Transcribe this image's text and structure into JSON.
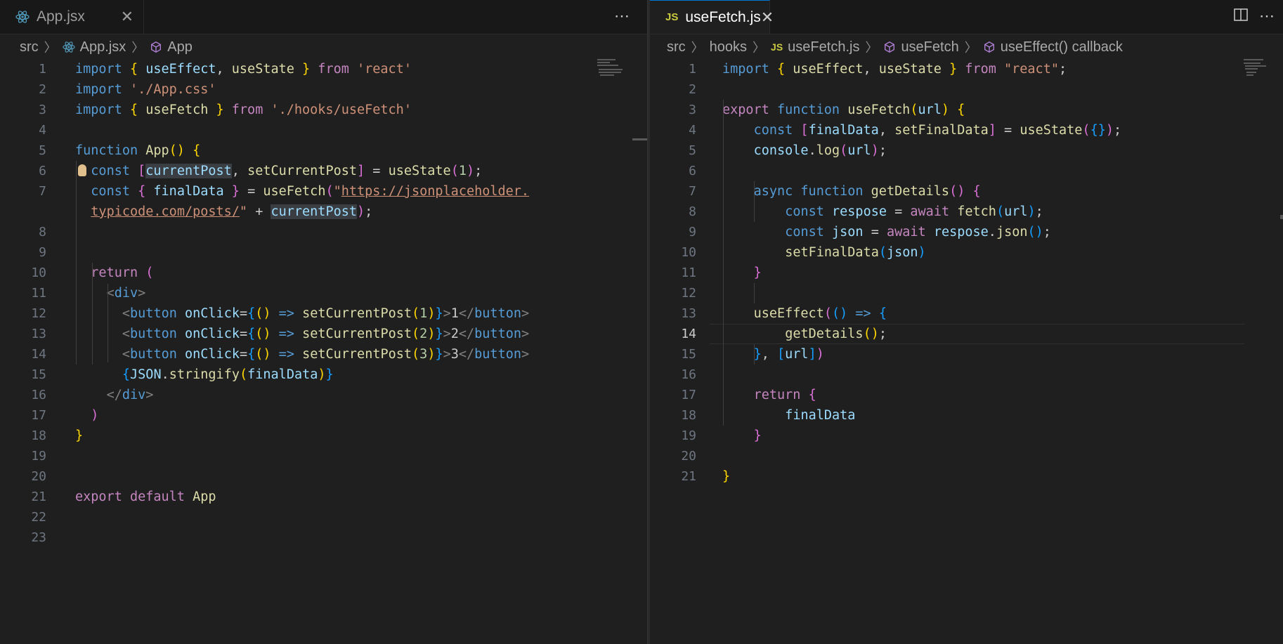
{
  "left_editor": {
    "tab": {
      "label": "App.jsx"
    },
    "breadcrumb": {
      "segments": [
        "src",
        "App.jsx",
        "App"
      ]
    },
    "lines": [
      {
        "n": "1",
        "tokens": [
          [
            "kw",
            "import "
          ],
          [
            "br1",
            "{ "
          ],
          [
            "var",
            "useEffect"
          ],
          [
            "plain",
            ", "
          ],
          [
            "fn",
            "useState"
          ],
          [
            "br1",
            " }"
          ],
          [
            "ctl",
            " from "
          ],
          [
            "str",
            "'react'"
          ]
        ]
      },
      {
        "n": "2",
        "tokens": [
          [
            "kw",
            "import "
          ],
          [
            "str",
            "'./App.css'"
          ]
        ]
      },
      {
        "n": "3",
        "tokens": [
          [
            "kw",
            "import "
          ],
          [
            "br1",
            "{ "
          ],
          [
            "fn",
            "useFetch"
          ],
          [
            "br1",
            " }"
          ],
          [
            "ctl",
            " from "
          ],
          [
            "str",
            "'./hooks/useFetch'"
          ]
        ]
      },
      {
        "n": "4",
        "tokens": []
      },
      {
        "n": "5",
        "tokens": [
          [
            "kw",
            "function "
          ],
          [
            "fn",
            "App"
          ],
          [
            "br1",
            "()"
          ],
          [
            "plain",
            " "
          ],
          [
            "br1",
            "{"
          ]
        ]
      },
      {
        "n": "6",
        "tokens": [
          [
            "kw",
            "const "
          ],
          [
            "br2",
            "["
          ],
          [
            "var hl",
            "currentPost"
          ],
          [
            "plain",
            ", "
          ],
          [
            "fn",
            "setCurrentPost"
          ],
          [
            "br2",
            "]"
          ],
          [
            "plain",
            " = "
          ],
          [
            "fn",
            "useState"
          ],
          [
            "br2",
            "("
          ],
          [
            "num",
            "1"
          ],
          [
            "br2",
            ")"
          ],
          [
            "plain",
            ";"
          ]
        ]
      },
      {
        "n": "7",
        "tokens": [
          [
            "kw",
            "const "
          ],
          [
            "br2",
            "{ "
          ],
          [
            "var",
            "finalData"
          ],
          [
            "br2",
            " }"
          ],
          [
            "plain",
            " = "
          ],
          [
            "fn",
            "useFetch"
          ],
          [
            "br2",
            "("
          ],
          [
            "str",
            "\""
          ],
          [
            "str u",
            "https://jsonplaceholder."
          ]
        ]
      },
      {
        "n": "",
        "tokens": [
          [
            "str u",
            "typicode.com/posts/"
          ],
          [
            "str",
            "\""
          ],
          [
            "plain",
            " + "
          ],
          [
            "var hl",
            "currentPost"
          ],
          [
            "br2",
            ")"
          ],
          [
            "plain",
            ";"
          ]
        ]
      },
      {
        "n": "8",
        "tokens": []
      },
      {
        "n": "9",
        "tokens": []
      },
      {
        "n": "10",
        "tokens": [
          [
            "ctl",
            "return "
          ],
          [
            "br2",
            "("
          ]
        ]
      },
      {
        "n": "11",
        "tokens": [
          [
            "tagb",
            "<"
          ],
          [
            "tag",
            "div"
          ],
          [
            "tagb",
            ">"
          ]
        ]
      },
      {
        "n": "12",
        "tokens": [
          [
            "tagb",
            "<"
          ],
          [
            "tag",
            "button "
          ],
          [
            "attr",
            "onClick"
          ],
          [
            "plain",
            "="
          ],
          [
            "br3",
            "{"
          ],
          [
            "br1",
            "()"
          ],
          [
            "kw",
            " => "
          ],
          [
            "fn",
            "setCurrentPost"
          ],
          [
            "br1",
            "("
          ],
          [
            "num",
            "1"
          ],
          [
            "br1",
            ")"
          ],
          [
            "br3",
            "}"
          ],
          [
            "tagb",
            ">"
          ],
          [
            "plain",
            "1"
          ],
          [
            "tagb",
            "</"
          ],
          [
            "tag",
            "button"
          ],
          [
            "tagb",
            ">"
          ]
        ]
      },
      {
        "n": "13",
        "tokens": [
          [
            "tagb",
            "<"
          ],
          [
            "tag",
            "button "
          ],
          [
            "attr",
            "onClick"
          ],
          [
            "plain",
            "="
          ],
          [
            "br3",
            "{"
          ],
          [
            "br1",
            "()"
          ],
          [
            "kw",
            " => "
          ],
          [
            "fn",
            "setCurrentPost"
          ],
          [
            "br1",
            "("
          ],
          [
            "num",
            "2"
          ],
          [
            "br1",
            ")"
          ],
          [
            "br3",
            "}"
          ],
          [
            "tagb",
            ">"
          ],
          [
            "plain",
            "2"
          ],
          [
            "tagb",
            "</"
          ],
          [
            "tag",
            "button"
          ],
          [
            "tagb",
            ">"
          ]
        ]
      },
      {
        "n": "14",
        "tokens": [
          [
            "tagb",
            "<"
          ],
          [
            "tag",
            "button "
          ],
          [
            "attr",
            "onClick"
          ],
          [
            "plain",
            "="
          ],
          [
            "br3",
            "{"
          ],
          [
            "br1",
            "()"
          ],
          [
            "kw",
            " => "
          ],
          [
            "fn",
            "setCurrentPost"
          ],
          [
            "br1",
            "("
          ],
          [
            "num",
            "3"
          ],
          [
            "br1",
            ")"
          ],
          [
            "br3",
            "}"
          ],
          [
            "tagb",
            ">"
          ],
          [
            "plain",
            "3"
          ],
          [
            "tagb",
            "</"
          ],
          [
            "tag",
            "button"
          ],
          [
            "tagb",
            ">"
          ]
        ]
      },
      {
        "n": "15",
        "tokens": [
          [
            "br3",
            "{"
          ],
          [
            "var",
            "JSON"
          ],
          [
            "plain",
            "."
          ],
          [
            "fn",
            "stringify"
          ],
          [
            "br1",
            "("
          ],
          [
            "var",
            "finalData"
          ],
          [
            "br1",
            ")"
          ],
          [
            "br3",
            "}"
          ]
        ]
      },
      {
        "n": "16",
        "tokens": [
          [
            "tagb",
            "</"
          ],
          [
            "tag",
            "div"
          ],
          [
            "tagb",
            ">"
          ]
        ]
      },
      {
        "n": "17",
        "tokens": [
          [
            "br2",
            ")"
          ]
        ]
      },
      {
        "n": "18",
        "tokens": [
          [
            "br1",
            "}"
          ]
        ]
      },
      {
        "n": "19",
        "tokens": []
      },
      {
        "n": "20",
        "tokens": []
      },
      {
        "n": "21",
        "tokens": [
          [
            "ctl",
            "export default "
          ],
          [
            "fn",
            "App"
          ]
        ]
      },
      {
        "n": "22",
        "tokens": []
      },
      {
        "n": "23",
        "tokens": []
      }
    ]
  },
  "right_editor": {
    "tab": {
      "label": "useFetch.js",
      "file_badge": "JS"
    },
    "breadcrumb": {
      "segments": [
        "src",
        "hooks",
        "useFetch.js",
        "useFetch",
        "useEffect() callback"
      ],
      "file_badge": "JS"
    },
    "active_line": "14",
    "lines": [
      {
        "n": "1",
        "tokens": [
          [
            "kw",
            "import "
          ],
          [
            "br1",
            "{ "
          ],
          [
            "fn",
            "useEffect"
          ],
          [
            "plain",
            ", "
          ],
          [
            "fn",
            "useState"
          ],
          [
            "br1",
            " }"
          ],
          [
            "ctl",
            " from "
          ],
          [
            "str",
            "\"react\""
          ],
          [
            "plain",
            ";"
          ]
        ]
      },
      {
        "n": "2",
        "tokens": []
      },
      {
        "n": "3",
        "tokens": [
          [
            "ctl",
            "export "
          ],
          [
            "kw",
            "function "
          ],
          [
            "fn",
            "useFetch"
          ],
          [
            "br1",
            "("
          ],
          [
            "var",
            "url"
          ],
          [
            "br1",
            ")"
          ],
          [
            "plain",
            " "
          ],
          [
            "br1",
            "{"
          ]
        ]
      },
      {
        "n": "4",
        "tokens": [
          [
            "kw",
            "const "
          ],
          [
            "br2",
            "["
          ],
          [
            "var",
            "finalData"
          ],
          [
            "plain",
            ", "
          ],
          [
            "fn",
            "setFinalData"
          ],
          [
            "br2",
            "]"
          ],
          [
            "plain",
            " = "
          ],
          [
            "fn",
            "useState"
          ],
          [
            "br2",
            "("
          ],
          [
            "br3",
            "{}"
          ],
          [
            "br2",
            ")"
          ],
          [
            "plain",
            ";"
          ]
        ]
      },
      {
        "n": "5",
        "tokens": [
          [
            "var",
            "console"
          ],
          [
            "plain",
            "."
          ],
          [
            "fn",
            "log"
          ],
          [
            "br2",
            "("
          ],
          [
            "var",
            "url"
          ],
          [
            "br2",
            ")"
          ],
          [
            "plain",
            ";"
          ]
        ]
      },
      {
        "n": "6",
        "tokens": []
      },
      {
        "n": "7",
        "tokens": [
          [
            "kw",
            "async function "
          ],
          [
            "fn",
            "getDetails"
          ],
          [
            "br2",
            "()"
          ],
          [
            "plain",
            " "
          ],
          [
            "br2",
            "{"
          ]
        ]
      },
      {
        "n": "8",
        "tokens": [
          [
            "kw",
            "const "
          ],
          [
            "var",
            "respose"
          ],
          [
            "plain",
            " = "
          ],
          [
            "ctl",
            "await "
          ],
          [
            "fn",
            "fetch"
          ],
          [
            "br3",
            "("
          ],
          [
            "var",
            "url"
          ],
          [
            "br3",
            ")"
          ],
          [
            "plain",
            ";"
          ]
        ]
      },
      {
        "n": "9",
        "tokens": [
          [
            "kw",
            "const "
          ],
          [
            "var",
            "json"
          ],
          [
            "plain",
            " = "
          ],
          [
            "ctl",
            "await "
          ],
          [
            "var",
            "respose"
          ],
          [
            "plain",
            "."
          ],
          [
            "fn",
            "json"
          ],
          [
            "br3",
            "()"
          ],
          [
            "plain",
            ";"
          ]
        ]
      },
      {
        "n": "10",
        "tokens": [
          [
            "fn",
            "setFinalData"
          ],
          [
            "br3",
            "("
          ],
          [
            "var",
            "json"
          ],
          [
            "br3",
            ")"
          ]
        ]
      },
      {
        "n": "11",
        "tokens": [
          [
            "br2",
            "}"
          ]
        ]
      },
      {
        "n": "12",
        "tokens": []
      },
      {
        "n": "13",
        "tokens": [
          [
            "fn",
            "useEffect"
          ],
          [
            "br2",
            "("
          ],
          [
            "br3",
            "()"
          ],
          [
            "kw",
            " => "
          ],
          [
            "br3",
            "{"
          ]
        ]
      },
      {
        "n": "14",
        "tokens": [
          [
            "fn",
            "getDetails"
          ],
          [
            "br1",
            "()"
          ],
          [
            "plain",
            ";"
          ]
        ]
      },
      {
        "n": "15",
        "tokens": [
          [
            "br3",
            "}"
          ],
          [
            "plain",
            ", "
          ],
          [
            "br3",
            "["
          ],
          [
            "var",
            "url"
          ],
          [
            "br3",
            "]"
          ],
          [
            "br2",
            ")"
          ]
        ]
      },
      {
        "n": "16",
        "tokens": []
      },
      {
        "n": "17",
        "tokens": [
          [
            "ctl",
            "return "
          ],
          [
            "br2",
            "{"
          ]
        ]
      },
      {
        "n": "18",
        "tokens": [
          [
            "var",
            "finalData"
          ]
        ]
      },
      {
        "n": "19",
        "tokens": [
          [
            "br2",
            "}"
          ]
        ]
      },
      {
        "n": "20",
        "tokens": []
      },
      {
        "n": "21",
        "tokens": [
          [
            "br1",
            "}"
          ]
        ]
      }
    ]
  },
  "icons": {
    "react": "react-icon",
    "symbol": "symbol-cube-icon",
    "more": "ellipsis-icon",
    "split": "split-editor-icon",
    "close": "close-icon"
  }
}
